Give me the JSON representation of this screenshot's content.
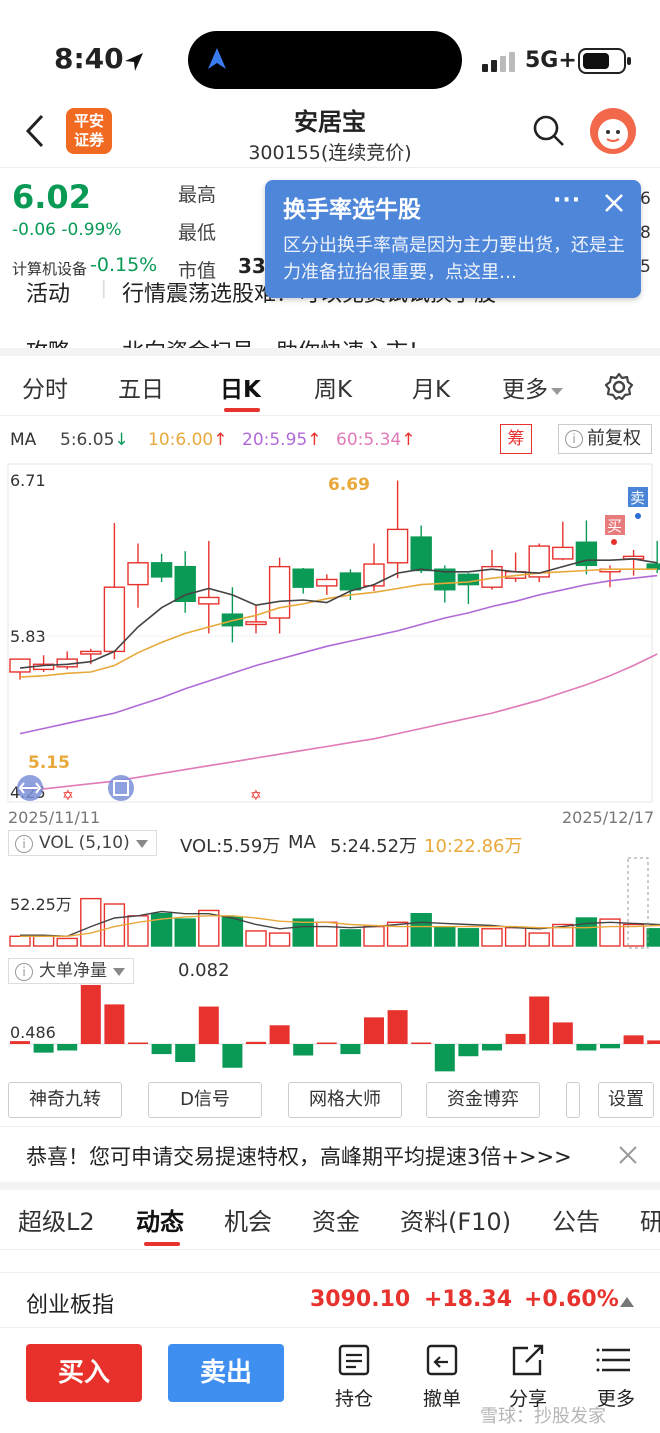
{
  "status": {
    "time": "8:40",
    "network": "5G+"
  },
  "header": {
    "brand": [
      "平安",
      "证券"
    ],
    "name": "安居宝",
    "code": "300155(连续竞价)"
  },
  "quote": {
    "price": "6.02",
    "change": "-0.06 -0.99%",
    "sector": "计算机设备",
    "sector_change": "-0.15%",
    "labels": {
      "high": "最高",
      "low": "最低",
      "mcap": "市值"
    },
    "mcap_partial": "33",
    "edge_values": [
      "6",
      "8",
      "5"
    ]
  },
  "popup": {
    "title": "换手率选牛股",
    "more": "···",
    "body": "区分出换手率高是因为主力要出货，还是主力准备拉抬很重要，点这里…"
  },
  "activity": {
    "label": "活动",
    "text": "行情震荡选股难？可以免费试试换手股"
  },
  "strategy": {
    "label": "攻略",
    "text": "北向资金扫号，助你快速入市！"
  },
  "kline_tabs": [
    "分时",
    "五日",
    "日K",
    "周K",
    "月K",
    "更多"
  ],
  "ma": {
    "label": "MA",
    "ma5": "5:6.05",
    "ma10": "10:6.00",
    "ma20": "20:5.95",
    "ma60": "60:5.34",
    "chip": "筹",
    "adjust": "前复权",
    "colors": {
      "ma5": "#444444",
      "ma10": "#e8a93a",
      "ma20": "#b06ad8",
      "ma60": "#e07ab8"
    }
  },
  "chart_data": {
    "type": "candlestick",
    "x_range": [
      "2025/11/11",
      "2025/12/17"
    ],
    "y_labels": [
      "6.71",
      "5.83"
    ],
    "annotations": {
      "high": "6.69",
      "low_marker": "5.15",
      "bottom_left": "4.25",
      "sell": "卖",
      "buy": "买"
    },
    "ylim": [
      4.25,
      6.71
    ],
    "candles": [
      {
        "o": 5.2,
        "h": 5.3,
        "l": 5.14,
        "c": 5.3
      },
      {
        "o": 5.22,
        "h": 5.33,
        "l": 5.2,
        "c": 5.26
      },
      {
        "o": 5.24,
        "h": 5.36,
        "l": 5.22,
        "c": 5.3
      },
      {
        "o": 5.34,
        "h": 5.38,
        "l": 5.26,
        "c": 5.36
      },
      {
        "o": 5.36,
        "h": 6.36,
        "l": 5.3,
        "c": 5.86
      },
      {
        "o": 5.88,
        "h": 6.2,
        "l": 5.7,
        "c": 6.05
      },
      {
        "o": 6.05,
        "h": 6.12,
        "l": 5.9,
        "c": 5.94
      },
      {
        "o": 6.02,
        "h": 6.14,
        "l": 5.66,
        "c": 5.75
      },
      {
        "o": 5.73,
        "h": 6.22,
        "l": 5.5,
        "c": 5.78
      },
      {
        "o": 5.65,
        "h": 5.86,
        "l": 5.43,
        "c": 5.56
      },
      {
        "o": 5.57,
        "h": 5.72,
        "l": 5.5,
        "c": 5.59
      },
      {
        "o": 5.62,
        "h": 6.09,
        "l": 5.5,
        "c": 6.02
      },
      {
        "o": 6.0,
        "h": 6.01,
        "l": 5.81,
        "c": 5.86
      },
      {
        "o": 5.87,
        "h": 5.96,
        "l": 5.8,
        "c": 5.92
      },
      {
        "o": 5.97,
        "h": 6.0,
        "l": 5.76,
        "c": 5.84
      },
      {
        "o": 5.87,
        "h": 6.2,
        "l": 5.83,
        "c": 6.04
      },
      {
        "o": 6.05,
        "h": 6.69,
        "l": 5.93,
        "c": 6.31
      },
      {
        "o": 6.25,
        "h": 6.34,
        "l": 5.97,
        "c": 5.99
      },
      {
        "o": 6.0,
        "h": 6.03,
        "l": 5.74,
        "c": 5.84
      },
      {
        "o": 5.96,
        "h": 5.97,
        "l": 5.73,
        "c": 5.88
      },
      {
        "o": 5.86,
        "h": 6.15,
        "l": 5.84,
        "c": 6.02
      },
      {
        "o": 5.93,
        "h": 6.13,
        "l": 5.9,
        "c": 5.98
      },
      {
        "o": 5.94,
        "h": 6.2,
        "l": 5.9,
        "c": 6.18
      },
      {
        "o": 6.08,
        "h": 6.37,
        "l": 6.07,
        "c": 6.17
      },
      {
        "o": 6.21,
        "h": 6.38,
        "l": 5.96,
        "c": 6.03
      },
      {
        "o": 5.98,
        "h": 6.03,
        "l": 5.86,
        "c": 6.0
      },
      {
        "o": 6.08,
        "h": 6.15,
        "l": 5.95,
        "c": 6.1
      },
      {
        "o": 6.04,
        "h": 6.22,
        "l": 5.97,
        "c": 6.0
      }
    ],
    "ma5_line": [
      5.23,
      5.25,
      5.26,
      5.28,
      5.36,
      5.55,
      5.7,
      5.8,
      5.85,
      5.8,
      5.72,
      5.75,
      5.76,
      5.74,
      5.83,
      5.88,
      5.97,
      6.0,
      5.98,
      5.98,
      6.0,
      5.98,
      5.97,
      6.02,
      6.07,
      6.07,
      6.08,
      6.05
    ],
    "ma10_line": [
      5.16,
      5.17,
      5.19,
      5.2,
      5.25,
      5.35,
      5.43,
      5.5,
      5.55,
      5.6,
      5.64,
      5.7,
      5.73,
      5.77,
      5.8,
      5.82,
      5.85,
      5.88,
      5.89,
      5.9,
      5.93,
      5.95,
      5.97,
      5.98,
      5.99,
      6.0,
      6.0,
      6.0
    ],
    "ma20_line": [
      4.72,
      4.76,
      4.8,
      4.84,
      4.88,
      4.94,
      5.0,
      5.07,
      5.13,
      5.19,
      5.25,
      5.3,
      5.35,
      5.4,
      5.44,
      5.48,
      5.52,
      5.57,
      5.62,
      5.66,
      5.71,
      5.75,
      5.8,
      5.84,
      5.88,
      5.91,
      5.93,
      5.95
    ],
    "ma60_line": [
      4.28,
      4.29,
      4.31,
      4.33,
      4.35,
      4.38,
      4.41,
      4.44,
      4.47,
      4.5,
      4.53,
      4.56,
      4.59,
      4.62,
      4.65,
      4.68,
      4.72,
      4.76,
      4.8,
      4.84,
      4.88,
      4.93,
      4.98,
      5.04,
      5.1,
      5.17,
      5.25,
      5.34
    ]
  },
  "vol": {
    "label": "VOL (5,10)",
    "vol": "VOL:5.59万",
    "ma_label": "MA",
    "ma5": "5:24.52万",
    "ma10": "10:22.86万",
    "y_label": "52.25万",
    "values": [
      9,
      9,
      7,
      44,
      39,
      28,
      30,
      25,
      33,
      27,
      14,
      12,
      25,
      22,
      15,
      18,
      22,
      30,
      17,
      16,
      16,
      17,
      12,
      20,
      26,
      25,
      20,
      16,
      4
    ],
    "ma5_line": [
      10,
      10,
      9,
      18,
      26,
      28,
      32,
      30,
      30,
      26,
      20,
      16,
      18,
      18,
      17,
      18,
      20,
      22,
      21,
      20,
      19,
      17,
      16,
      18,
      21,
      22,
      21,
      20,
      18
    ],
    "ma10_line": [
      9,
      9,
      9,
      12,
      18,
      22,
      25,
      27,
      28,
      28,
      26,
      23,
      22,
      22,
      20,
      19,
      18,
      18,
      18,
      18,
      18,
      18,
      17,
      17,
      17,
      18,
      18,
      19,
      19
    ]
  },
  "net_flow": {
    "label": "大单净量",
    "value": "0.082",
    "y_label": "0.486",
    "values": [
      0.04,
      -0.12,
      -0.09,
      0.82,
      0.55,
      0.02,
      -0.14,
      -0.25,
      0.52,
      -0.33,
      0.03,
      0.26,
      -0.16,
      0.02,
      -0.14,
      0.37,
      0.47,
      0.02,
      -0.38,
      -0.17,
      -0.09,
      0.14,
      0.66,
      0.3,
      -0.09,
      -0.06,
      0.12,
      0.05
    ]
  },
  "tools": [
    "神奇九转",
    "D信号",
    "网格大师",
    "资金博弈",
    "设置"
  ],
  "notice": {
    "text": "恭喜！您可申请交易提速特权，高峰期平均提速3倍+>>>"
  },
  "info_tabs": [
    "超级L2",
    "动态",
    "机会",
    "资金",
    "资料(F10)",
    "公告",
    "研"
  ],
  "index": {
    "name": "创业板指",
    "value": "3090.10",
    "change": "+18.34",
    "pct": "+0.60%"
  },
  "actions": {
    "buy": "买入",
    "sell": "卖出",
    "items": [
      "持仓",
      "撤单",
      "分享",
      "更多"
    ]
  },
  "watermark": "雪球：抄股发家"
}
